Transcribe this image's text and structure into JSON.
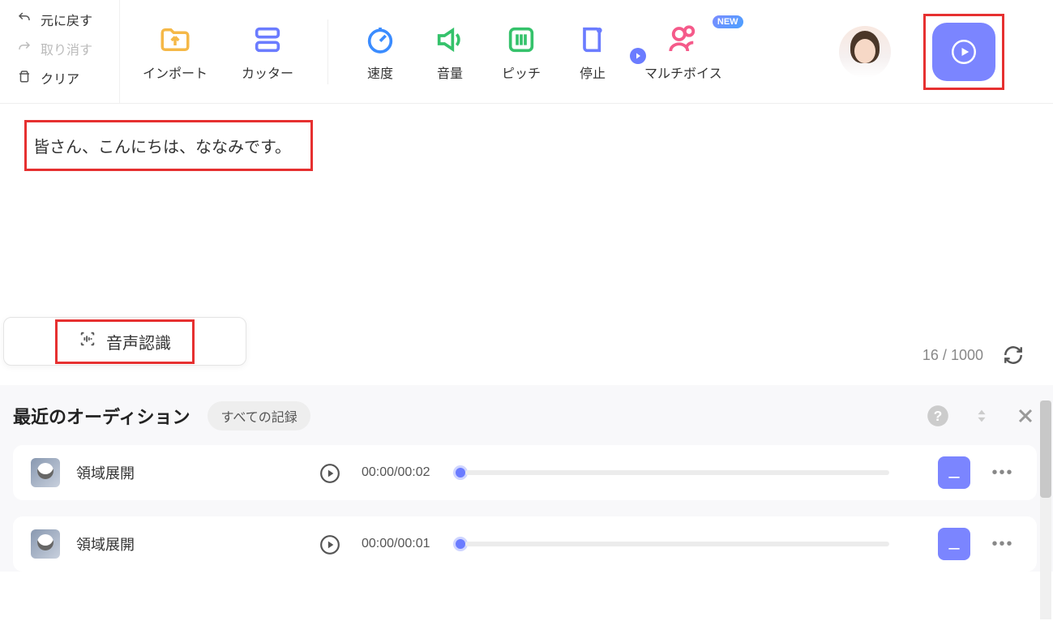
{
  "toolbar_left": {
    "undo": "元に戻す",
    "redo": "取り消す",
    "clear": "クリア"
  },
  "toolbar": {
    "import": "インポート",
    "cutter": "カッター",
    "speed": "速度",
    "volume": "音量",
    "pitch": "ピッチ",
    "stop": "停止",
    "multivoice": "マルチボイス",
    "new_badge": "NEW"
  },
  "editor": {
    "text": "皆さん、こんにちは、ななみです。"
  },
  "voice_recog": {
    "label": "音声認識"
  },
  "counter": {
    "current": "16",
    "separator": "/",
    "max": "1000"
  },
  "lower": {
    "title": "最近のオーディション",
    "chip": "すべての記録",
    "records": [
      {
        "title": "領域展開",
        "time": "00:00/00:02"
      },
      {
        "title": "領域展開",
        "time": "00:00/00:01"
      }
    ]
  }
}
